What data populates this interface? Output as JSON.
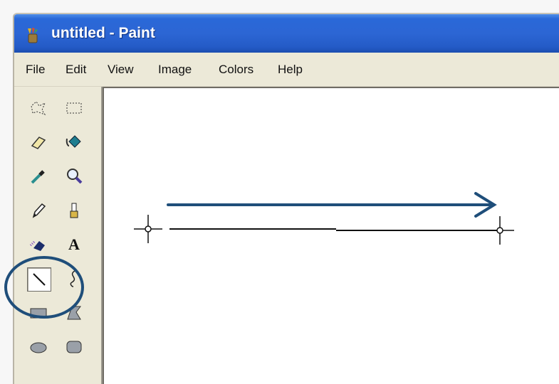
{
  "window": {
    "title": "untitled - Paint",
    "app_icon": "paint-bucket-icon"
  },
  "menu": {
    "items": [
      "File",
      "Edit",
      "View",
      "Image",
      "Colors",
      "Help"
    ]
  },
  "toolbox": {
    "tools": [
      {
        "name": "free-form-select-icon"
      },
      {
        "name": "rect-select-icon"
      },
      {
        "name": "eraser-icon"
      },
      {
        "name": "fill-bucket-icon"
      },
      {
        "name": "color-picker-icon"
      },
      {
        "name": "magnifier-icon"
      },
      {
        "name": "pencil-icon"
      },
      {
        "name": "brush-icon"
      },
      {
        "name": "airbrush-icon"
      },
      {
        "name": "text-icon",
        "glyph": "A"
      },
      {
        "name": "line-icon",
        "selected": true
      },
      {
        "name": "curve-icon"
      },
      {
        "name": "rectangle-icon"
      },
      {
        "name": "polygon-icon"
      },
      {
        "name": "ellipse-icon"
      },
      {
        "name": "rounded-rectangle-icon"
      }
    ]
  },
  "annotation": {
    "arrow_color": "#1f4e7a",
    "circle_color": "#1f4e7a"
  }
}
